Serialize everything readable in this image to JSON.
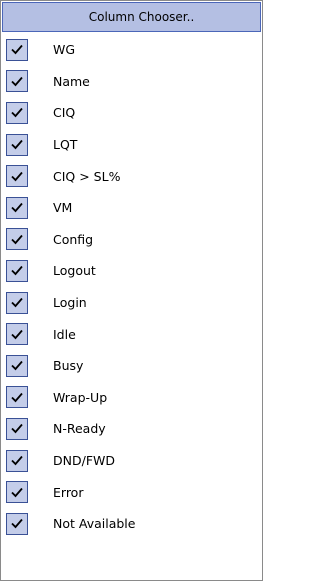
{
  "menu": {
    "title": "Column Chooser..",
    "items": [
      {
        "label": "WG",
        "checked": true
      },
      {
        "label": "Name",
        "checked": true
      },
      {
        "label": "CIQ",
        "checked": true
      },
      {
        "label": "LQT",
        "checked": true
      },
      {
        "label": "CIQ > SL%",
        "checked": true
      },
      {
        "label": "VM",
        "checked": true
      },
      {
        "label": "Config",
        "checked": true
      },
      {
        "label": "Logout",
        "checked": true
      },
      {
        "label": "Login",
        "checked": true
      },
      {
        "label": "Idle",
        "checked": true
      },
      {
        "label": "Busy",
        "checked": true
      },
      {
        "label": "Wrap-Up",
        "checked": true
      },
      {
        "label": "N-Ready",
        "checked": true
      },
      {
        "label": "DND/FWD",
        "checked": true
      },
      {
        "label": "Error",
        "checked": true
      },
      {
        "label": "Not Available",
        "checked": true
      }
    ]
  },
  "icons": {
    "check": "checkmark-icon"
  },
  "colors": {
    "title_bg": "#b4bfe3",
    "title_border": "#4b66b8",
    "check_bg": "#c4cde9",
    "check_border": "#3a5196"
  }
}
